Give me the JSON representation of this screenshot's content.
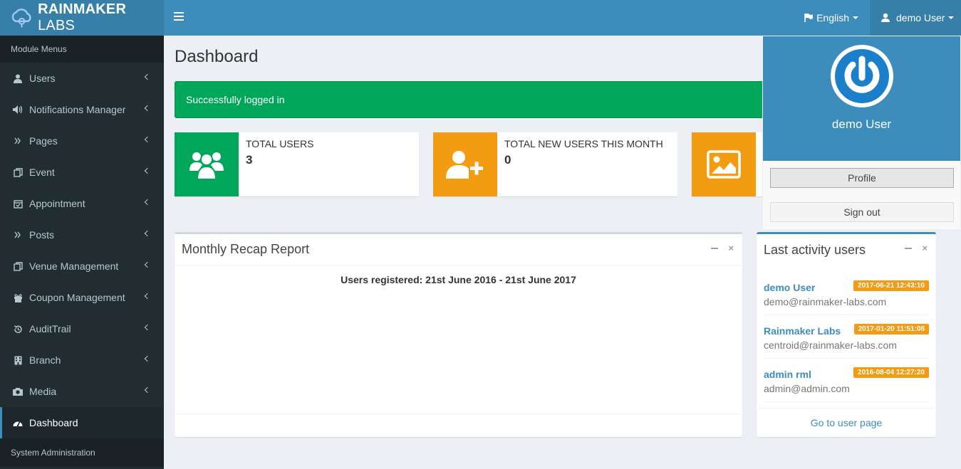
{
  "brand": {
    "name_bold": "RAINMAKER",
    "name_rest": " LABS"
  },
  "header": {
    "language": "English",
    "user": "demo User"
  },
  "sidebar": {
    "section1": "Module Menus",
    "items": [
      {
        "label": "Users",
        "icon": "user-icon"
      },
      {
        "label": "Notifications Manager",
        "icon": "volume-icon"
      },
      {
        "label": "Pages",
        "icon": "double-chevron-icon"
      },
      {
        "label": "Event",
        "icon": "copy-icon"
      },
      {
        "label": "Appointment",
        "icon": "calendar-check-icon"
      },
      {
        "label": "Posts",
        "icon": "double-chevron-icon"
      },
      {
        "label": "Venue Management",
        "icon": "copy-icon"
      },
      {
        "label": "Coupon Management",
        "icon": "gift-icon"
      },
      {
        "label": "AuditTrail",
        "icon": "history-icon"
      },
      {
        "label": "Branch",
        "icon": "building-icon"
      },
      {
        "label": "Media",
        "icon": "camera-icon"
      },
      {
        "label": "Dashboard",
        "icon": "dashboard-icon"
      }
    ],
    "section2": "System Administration"
  },
  "main": {
    "title": "Dashboard",
    "alert": "Successfully logged in",
    "info_boxes": [
      {
        "label": "TOTAL USERS",
        "value": "3",
        "color": "#00a65a",
        "icon": "users-icon"
      },
      {
        "label": "TOTAL NEW USERS THIS MONTH",
        "value": "0",
        "color": "#f39c12",
        "icon": "user-plus-icon"
      },
      {
        "label": "",
        "value": "",
        "color": "#f39c12",
        "icon": "image-icon"
      }
    ]
  },
  "recap": {
    "title": "Monthly Recap Report",
    "chart_title": "Users registered: 21st June 2016 - 21st June 2017"
  },
  "activity": {
    "title": "Last activity users",
    "items": [
      {
        "name": "demo User",
        "email": "demo@rainmaker-labs.com",
        "time": "2017-06-21 12:43:10"
      },
      {
        "name": "Rainmaker Labs",
        "email": "centroid@rainmaker-labs.com",
        "time": "2017-01-20 11:51:08"
      },
      {
        "name": "admin rml",
        "email": "admin@admin.com",
        "time": "2016-08-04 12:27:20"
      }
    ],
    "footer_link": "Go to user page"
  },
  "dropdown": {
    "name": "demo User",
    "profile": "Profile",
    "signout": "Sign out"
  }
}
